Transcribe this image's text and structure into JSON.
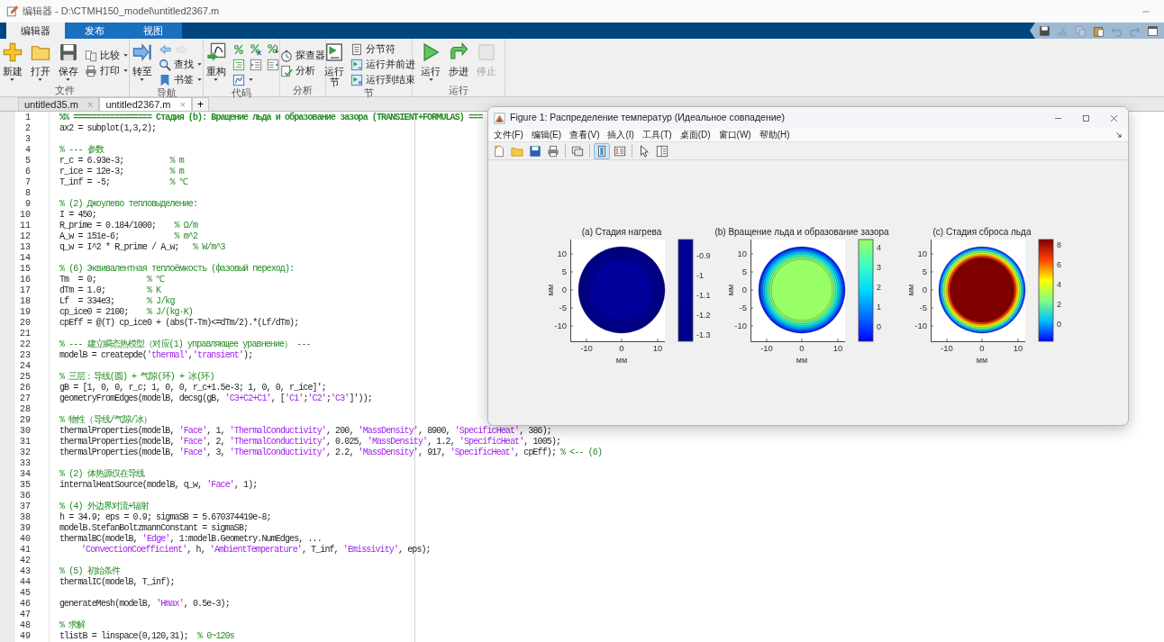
{
  "window": {
    "title": "编辑器 - D:\\CTMH150_model\\untitled2367.m"
  },
  "ribbon_tabs": [
    {
      "label": "编辑器",
      "selected": true
    },
    {
      "label": "发布",
      "selected": false
    },
    {
      "label": "视图",
      "selected": false
    }
  ],
  "ribbon_groups": [
    {
      "label": "文件",
      "columns": [
        [
          [
            {
              "kind": "large",
              "label": "新建",
              "dropdown": true,
              "disabled": false
            }
          ]
        ],
        [
          [
            {
              "kind": "large",
              "label": "打开",
              "dropdown": true,
              "disabled": false
            }
          ]
        ],
        [
          [
            {
              "kind": "large",
              "label": "保存",
              "dropdown": true,
              "disabled": false
            }
          ]
        ],
        [
          [
            {
              "kind": "small",
              "label": "比较",
              "dropdown": true,
              "disabled": false
            }
          ],
          [
            {
              "kind": "small",
              "label": "打印",
              "dropdown": true,
              "disabled": false
            }
          ]
        ]
      ]
    },
    {
      "label": "导航",
      "columns": [
        [
          [
            {
              "kind": "large",
              "label": "转至",
              "dropdown": true,
              "disabled": false
            }
          ]
        ],
        [
          [
            {
              "kind": "icon",
              "dropdown": false,
              "disabled": false
            },
            {
              "kind": "icon",
              "dropdown": false,
              "disabled": true
            }
          ],
          [
            {
              "kind": "small",
              "label": "查找",
              "dropdown": true,
              "disabled": false
            }
          ],
          [
            {
              "kind": "small",
              "label": "书签",
              "dropdown": true,
              "disabled": false
            }
          ]
        ]
      ]
    },
    {
      "label": "代码",
      "columns": [
        [
          [
            {
              "kind": "large",
              "label": "重构",
              "dropdown": true,
              "disabled": false
            }
          ]
        ],
        [
          [
            {
              "kind": "icon",
              "dropdown": false,
              "disabled": false
            },
            {
              "kind": "icon",
              "dropdown": false,
              "disabled": false
            },
            {
              "kind": "icon",
              "dropdown": false,
              "disabled": false
            }
          ],
          [
            {
              "kind": "icon",
              "dropdown": false,
              "disabled": false
            },
            {
              "kind": "icon",
              "dropdown": false,
              "disabled": false
            },
            {
              "kind": "icon",
              "dropdown": false,
              "disabled": false
            }
          ],
          [
            {
              "kind": "icon",
              "dropdown": true,
              "disabled": false
            }
          ]
        ]
      ]
    },
    {
      "label": "分析",
      "columns": [
        [
          [
            {
              "kind": "small",
              "label": "探查器",
              "dropdown": false,
              "disabled": false
            }
          ],
          [
            {
              "kind": "small",
              "label": "分析",
              "dropdown": false,
              "disabled": false
            }
          ]
        ]
      ]
    },
    {
      "label": "节",
      "columns": [
        [
          [
            {
              "kind": "large",
              "label": "运行节",
              "dropdown": false,
              "disabled": false
            }
          ]
        ],
        [
          [
            {
              "kind": "small",
              "label": "分节符",
              "dropdown": false,
              "disabled": false
            }
          ],
          [
            {
              "kind": "small",
              "label": "运行并前进",
              "dropdown": false,
              "disabled": false
            }
          ],
          [
            {
              "kind": "small",
              "label": "运行到结束",
              "dropdown": false,
              "disabled": false
            }
          ]
        ]
      ]
    },
    {
      "label": "运行",
      "columns": [
        [
          [
            {
              "kind": "large",
              "label": "运行",
              "dropdown": true,
              "disabled": false
            }
          ]
        ],
        [
          [
            {
              "kind": "large",
              "label": "步进",
              "dropdown": false,
              "disabled": false
            }
          ]
        ],
        [
          [
            {
              "kind": "large",
              "label": "停止",
              "dropdown": false,
              "disabled": true
            }
          ]
        ]
      ]
    }
  ],
  "doc_tabs": [
    {
      "label": "untitled35.m",
      "close": "×",
      "selected": false
    },
    {
      "label": "untitled2367.m",
      "close": "×",
      "selected": true
    }
  ],
  "new_tab": "+",
  "editor": {
    "lines": [
      {
        "n": "1",
        "segs": [
          {
            "kind": "section",
            "text": "%% ================= Стадия (b): Вращение льда и образование зазора (TRANSIENT+FORMULAS) ==="
          }
        ]
      },
      {
        "n": "2",
        "segs": [
          {
            "kind": "code",
            "text": "ax2 = subplot(1,3,2);"
          }
        ]
      },
      {
        "n": "3"
      },
      {
        "n": "4",
        "segs": [
          {
            "kind": "comment",
            "text": "% --- 参数"
          }
        ]
      },
      {
        "n": "5",
        "segs": [
          {
            "kind": "code",
            "text": "r_c = 6.93e-3;          "
          },
          {
            "kind": "comment",
            "text": "% m"
          }
        ]
      },
      {
        "n": "6",
        "segs": [
          {
            "kind": "code",
            "text": "r_ice = 12e-3;          "
          },
          {
            "kind": "comment",
            "text": "% m"
          }
        ]
      },
      {
        "n": "7",
        "segs": [
          {
            "kind": "code",
            "text": "T_inf = -5;             "
          },
          {
            "kind": "comment",
            "text": "% ℃"
          }
        ]
      },
      {
        "n": "8"
      },
      {
        "n": "9",
        "segs": [
          {
            "kind": "comment",
            "text": "% (2) Джоулево тепловыделение:"
          }
        ]
      },
      {
        "n": "10",
        "segs": [
          {
            "kind": "code",
            "text": "I = 450;"
          }
        ]
      },
      {
        "n": "11",
        "segs": [
          {
            "kind": "code",
            "text": "R_prime = 0.184/1000;    "
          },
          {
            "kind": "comment",
            "text": "% Ω/m"
          }
        ]
      },
      {
        "n": "12",
        "segs": [
          {
            "kind": "code",
            "text": "A_w = 151e-6;            "
          },
          {
            "kind": "comment",
            "text": "% m^2"
          }
        ]
      },
      {
        "n": "13",
        "segs": [
          {
            "kind": "code",
            "text": "q_w = I^2 * R_prime / A_w;   "
          },
          {
            "kind": "comment",
            "text": "% W/m^3"
          }
        ]
      },
      {
        "n": "14"
      },
      {
        "n": "15",
        "segs": [
          {
            "kind": "comment",
            "text": "% (6) Эквивалентная теплоёмкость (фазовый переход):"
          }
        ]
      },
      {
        "n": "16",
        "segs": [
          {
            "kind": "code",
            "text": "Tm  = 0;           "
          },
          {
            "kind": "comment",
            "text": "% ℃"
          }
        ]
      },
      {
        "n": "17",
        "segs": [
          {
            "kind": "code",
            "text": "dTm = 1.0;         "
          },
          {
            "kind": "comment",
            "text": "% K"
          }
        ]
      },
      {
        "n": "18",
        "segs": [
          {
            "kind": "code",
            "text": "Lf  = 334e3;       "
          },
          {
            "kind": "comment",
            "text": "% J/kg"
          }
        ]
      },
      {
        "n": "19",
        "segs": [
          {
            "kind": "code",
            "text": "cp_ice0 = 2100;    "
          },
          {
            "kind": "comment",
            "text": "% J/(kg·K)"
          }
        ]
      },
      {
        "n": "20",
        "segs": [
          {
            "kind": "code",
            "text": "cpEff = @(T) cp_ice0 + (abs(T-Tm)<=dTm/2).*(Lf/dTm);"
          }
        ]
      },
      {
        "n": "21"
      },
      {
        "n": "22",
        "segs": [
          {
            "kind": "comment",
            "text": "% --- 建立瞬态热模型（对应(1) управляющее уравнение） ---"
          }
        ]
      },
      {
        "n": "23",
        "segs": [
          {
            "kind": "code",
            "text": "modelB = createpde("
          },
          {
            "kind": "string",
            "text": "'thermal'"
          },
          {
            "kind": "code",
            "text": ","
          },
          {
            "kind": "string",
            "text": "'transient'"
          },
          {
            "kind": "code",
            "text": ");"
          }
        ]
      },
      {
        "n": "24"
      },
      {
        "n": "25",
        "segs": [
          {
            "kind": "comment",
            "text": "% 三层：导线(圆) + 气隙(环) + 冰(环)"
          }
        ]
      },
      {
        "n": "26",
        "segs": [
          {
            "kind": "code",
            "text": "gB = [1, 0, 0, r_c; 1, 0, 0, r_c+1.5e-3; 1, 0, 0, r_ice]';"
          }
        ]
      },
      {
        "n": "27",
        "segs": [
          {
            "kind": "code",
            "text": "geometryFromEdges(modelB, decsg(gB, "
          },
          {
            "kind": "string",
            "text": "'C3+C2+C1'"
          },
          {
            "kind": "code",
            "text": ", ["
          },
          {
            "kind": "string",
            "text": "'C1'"
          },
          {
            "kind": "code",
            "text": ";"
          },
          {
            "kind": "string",
            "text": "'C2'"
          },
          {
            "kind": "code",
            "text": ";"
          },
          {
            "kind": "string",
            "text": "'C3'"
          },
          {
            "kind": "code",
            "text": "]'));"
          }
        ]
      },
      {
        "n": "28"
      },
      {
        "n": "29",
        "segs": [
          {
            "kind": "comment",
            "text": "% 物性（导线/气隙/冰）"
          }
        ]
      },
      {
        "n": "30",
        "segs": [
          {
            "kind": "code",
            "text": "thermalProperties(modelB, "
          },
          {
            "kind": "string",
            "text": "'Face'"
          },
          {
            "kind": "code",
            "text": ", 1, "
          },
          {
            "kind": "string",
            "text": "'ThermalConductivity'"
          },
          {
            "kind": "code",
            "text": ", 200, "
          },
          {
            "kind": "string",
            "text": "'MassDensity'"
          },
          {
            "kind": "code",
            "text": ", 8900, "
          },
          {
            "kind": "string",
            "text": "'SpecificHeat'"
          },
          {
            "kind": "code",
            "text": ", 386);"
          }
        ]
      },
      {
        "n": "31",
        "segs": [
          {
            "kind": "code",
            "text": "thermalProperties(modelB, "
          },
          {
            "kind": "string",
            "text": "'Face'"
          },
          {
            "kind": "code",
            "text": ", 2, "
          },
          {
            "kind": "string",
            "text": "'ThermalConductivity'"
          },
          {
            "kind": "code",
            "text": ", 0.025, "
          },
          {
            "kind": "string",
            "text": "'MassDensity'"
          },
          {
            "kind": "code",
            "text": ", 1.2, "
          },
          {
            "kind": "string",
            "text": "'SpecificHeat'"
          },
          {
            "kind": "code",
            "text": ", 1005);"
          }
        ]
      },
      {
        "n": "32",
        "segs": [
          {
            "kind": "code",
            "text": "thermalProperties(modelB, "
          },
          {
            "kind": "string",
            "text": "'Face'"
          },
          {
            "kind": "code",
            "text": ", 3, "
          },
          {
            "kind": "string",
            "text": "'ThermalConductivity'"
          },
          {
            "kind": "code",
            "text": ", 2.2, "
          },
          {
            "kind": "string",
            "text": "'MassDensity'"
          },
          {
            "kind": "code",
            "text": ", 917, "
          },
          {
            "kind": "string",
            "text": "'SpecificHeat'"
          },
          {
            "kind": "code",
            "text": ", cpEff); "
          },
          {
            "kind": "comment",
            "text": "% <-- (6)"
          }
        ]
      },
      {
        "n": "33"
      },
      {
        "n": "34",
        "segs": [
          {
            "kind": "comment",
            "text": "% (2) 体热源仅在导线"
          }
        ]
      },
      {
        "n": "35",
        "segs": [
          {
            "kind": "code",
            "text": "internalHeatSource(modelB, q_w, "
          },
          {
            "kind": "string",
            "text": "'Face'"
          },
          {
            "kind": "code",
            "text": ", 1);"
          }
        ]
      },
      {
        "n": "36"
      },
      {
        "n": "37",
        "segs": [
          {
            "kind": "comment",
            "text": "% (4) 外边界对流+辐射"
          }
        ]
      },
      {
        "n": "38",
        "segs": [
          {
            "kind": "code",
            "text": "h = 34.9; eps = 0.9; sigmaSB = 5.670374419e-8;"
          }
        ]
      },
      {
        "n": "39",
        "segs": [
          {
            "kind": "code",
            "text": "modelB.StefanBoltzmannConstant = sigmaSB;"
          }
        ]
      },
      {
        "n": "40",
        "segs": [
          {
            "kind": "code",
            "text": "thermalBC(modelB, "
          },
          {
            "kind": "string",
            "text": "'Edge'"
          },
          {
            "kind": "code",
            "text": ", 1:modelB.Geometry.NumEdges, ..."
          }
        ]
      },
      {
        "n": "41",
        "indent": true,
        "segs": [
          {
            "kind": "string",
            "text": "'ConvectionCoefficient'"
          },
          {
            "kind": "code",
            "text": ", h, "
          },
          {
            "kind": "string",
            "text": "'AmbientTemperature'"
          },
          {
            "kind": "code",
            "text": ", T_inf, "
          },
          {
            "kind": "string",
            "text": "'Emissivity'"
          },
          {
            "kind": "code",
            "text": ", eps);"
          }
        ]
      },
      {
        "n": "42"
      },
      {
        "n": "43",
        "segs": [
          {
            "kind": "comment",
            "text": "% (5) 初始条件"
          }
        ]
      },
      {
        "n": "44",
        "segs": [
          {
            "kind": "code",
            "text": "thermalIC(modelB, T_inf);"
          }
        ]
      },
      {
        "n": "45"
      },
      {
        "n": "46",
        "segs": [
          {
            "kind": "code",
            "text": "generateMesh(modelB, "
          },
          {
            "kind": "string",
            "text": "'Hmax'"
          },
          {
            "kind": "code",
            "text": ", 0.5e-3);"
          }
        ]
      },
      {
        "n": "47"
      },
      {
        "n": "48",
        "segs": [
          {
            "kind": "comment",
            "text": "% 求解"
          }
        ]
      },
      {
        "n": "49",
        "segs": [
          {
            "kind": "code",
            "text": "tlistB = linspace(0,120,31);  "
          },
          {
            "kind": "comment",
            "text": "% 0~120s"
          }
        ]
      }
    ]
  },
  "figure": {
    "title": "Figure 1: Распределение температур (Идеальное совпадение)",
    "menu": [
      "文件(F)",
      "编辑(E)",
      "查看(V)",
      "插入(I)",
      "工具(T)",
      "桌面(D)",
      "窗口(W)",
      "帮助(H)"
    ],
    "toolbar": [
      {
        "kind": "button",
        "selected": false
      },
      {
        "kind": "button",
        "selected": false
      },
      {
        "kind": "button",
        "selected": false
      },
      {
        "kind": "button",
        "selected": false
      },
      {
        "kind": "separator"
      },
      {
        "kind": "button",
        "selected": false
      },
      {
        "kind": "separator"
      },
      {
        "kind": "button",
        "selected": true
      },
      {
        "kind": "button",
        "selected": false
      },
      {
        "kind": "separator"
      },
      {
        "kind": "button",
        "selected": false
      },
      {
        "kind": "button",
        "selected": false
      }
    ],
    "plots": [
      {
        "title": "(a) Стадия нагрева",
        "ylabel": "мм",
        "xlabel": "мм",
        "yticks": [
          "10",
          "5",
          "0",
          "-5",
          "-10"
        ],
        "xticks": [
          "-10",
          "0",
          "10"
        ],
        "colorbar_ticks": [
          "-0.9",
          "-1",
          "-1.1",
          "-1.2",
          "-1.3"
        ],
        "color": "#00009a"
      },
      {
        "title": "(b) Вращение льда и образование зазора",
        "ylabel": "мм",
        "xlabel": "мм",
        "yticks": [
          "10",
          "5",
          "0",
          "-5",
          "-10"
        ],
        "xticks": [
          "-10",
          "0",
          "10"
        ],
        "colorbar_ticks": [
          "4",
          "3",
          "2",
          "1",
          "0"
        ],
        "color": "#99ff66"
      },
      {
        "title": "(c) Стадия сброса льда",
        "ylabel": "мм",
        "xlabel": "мм",
        "yticks": [
          "10",
          "5",
          "0",
          "-5",
          "-10"
        ],
        "xticks": [
          "-10",
          "0",
          "10"
        ],
        "colorbar_ticks": [
          "8",
          "6",
          "4",
          "2",
          "0"
        ],
        "color": "#800000"
      }
    ]
  }
}
